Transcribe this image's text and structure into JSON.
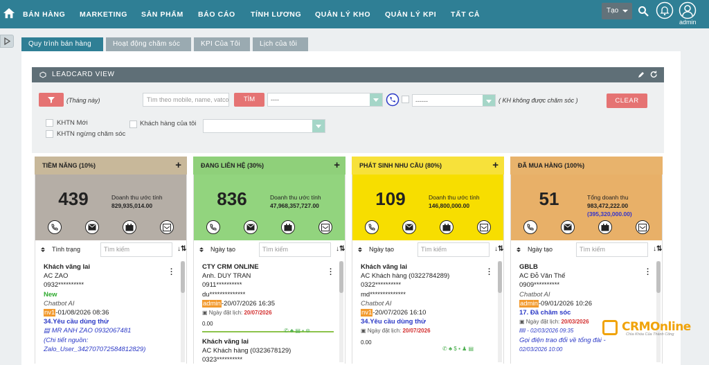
{
  "nav": {
    "items": [
      "BÁN HÀNG",
      "MARKETING",
      "SẢN PHẨM",
      "BÁO CÁO",
      "TÍNH LƯƠNG",
      "QUẢN LÝ KHO",
      "QUẢN LÝ KPI",
      "TẤT CẢ"
    ],
    "create_label": "Tạo",
    "user_label": "admin"
  },
  "tabs": [
    "Quy trình bán hàng",
    "Hoạt động chăm sóc",
    "KPI Của Tôi",
    "Lịch của tôi"
  ],
  "leadcard": {
    "title": "LEADCARD VIEW"
  },
  "filters": {
    "period": "(Tháng này)",
    "search_placeholder": "Tìm theo mobile, name, vatcod",
    "search_button": "TÌM",
    "select1": "----",
    "select2": "------",
    "care_note": "( KH không được chăm sóc )",
    "clear_button": "CLEAR",
    "chk_new": "KHTN Mới",
    "chk_stop": "KHTN ngừng chăm sóc",
    "chk_mine": "Khách hàng của tôi"
  },
  "columns": [
    {
      "title": "TIỀM NĂNG (10%)",
      "color": "#c8b89a",
      "stat_bg": "#b5aea6",
      "count": "439",
      "rev_label": "Doanh thu ước tính",
      "rev_value": "829,935,014.00",
      "rev_value2": "",
      "sort_label": "Tình trạng",
      "search_placeholder": "Tìm kiếm",
      "cards": [
        {
          "lines": [
            "Khách vãng lai",
            "AC ZAO",
            "0932**********",
            "New",
            "Chatbot AI",
            "nv1-01/08/2026 08:36",
            "34.Yêu cầu dùng thử",
            "MR ANH ZAO 0932067481",
            "(Chi tiết nguồn:",
            "Zalo_User_342707072584812829)"
          ]
        }
      ]
    },
    {
      "title": "ĐANG LIÊN HỆ (30%)",
      "color": "#8fd07a",
      "stat_bg": "#92d47e",
      "count": "836",
      "rev_label": "Doanh thu ước tính",
      "rev_value": "47,968,357,727.00",
      "rev_value2": "",
      "sort_label": "Ngày tạo",
      "search_placeholder": "Tìm kiếm",
      "cards": [
        {
          "lines": [
            "CTY CRM ONLINE",
            "Anh. DUY TRAN",
            "0911**********",
            "du**************",
            "admin-20/07/2026 16:35",
            "Ngày đặt lịch: 20/07/2026",
            "0.00"
          ]
        },
        {
          "lines": [
            "Khách vãng lai",
            "AC Khách hàng (0323678129)",
            "0323**********"
          ]
        }
      ]
    },
    {
      "title": "PHÁT SINH NHU CẦU (80%)",
      "color": "#f7e13a",
      "stat_bg": "#f7de00",
      "count": "109",
      "rev_label": "Doanh thu ước tính",
      "rev_value": "146,800,000.00",
      "rev_value2": "",
      "sort_label": "Ngày tạo",
      "search_placeholder": "Tìm kiếm",
      "cards": [
        {
          "lines": [
            "Khách vãng lai",
            "AC Khách hàng (0322784289)",
            "0322**********",
            "md**************",
            "Chatbot AI",
            "nv1-20/07/2026 16:10",
            "34.Yêu cầu dùng thử",
            "Ngày đặt lịch: 20/07/2026",
            "0.00"
          ]
        }
      ]
    },
    {
      "title": "ĐÃ MUA HÀNG (100%)",
      "color": "#e8b36c",
      "stat_bg": "#e8b068",
      "count": "51",
      "rev_label": "Tổng doanh thu",
      "rev_value": "983,472,222.00",
      "rev_value2": "(395,320,000.00)",
      "sort_label": "Ngày tạo",
      "search_placeholder": "Tìm kiếm",
      "cards": [
        {
          "lines": [
            "GBLB",
            "AC Đỗ Văn Thế",
            "0909**********",
            "Chatbot AI",
            "admin-09/01/2026 10:26",
            "17. Đã chăm sóc",
            "Ngày đặt lịch: 20/03/2026",
            "lllll - 02/03/2026 09:35",
            "Gọi điện trao đổi về tổng đài -",
            "02/03/2026 10:00"
          ]
        }
      ]
    }
  ],
  "logo": {
    "text": "CRMOnline",
    "slogan": "Chìa Khóa Của Thành Công"
  },
  "colors": {
    "nav": "#2f7f95",
    "accent_red": "#e57373",
    "highlight": "#f29a2e"
  }
}
